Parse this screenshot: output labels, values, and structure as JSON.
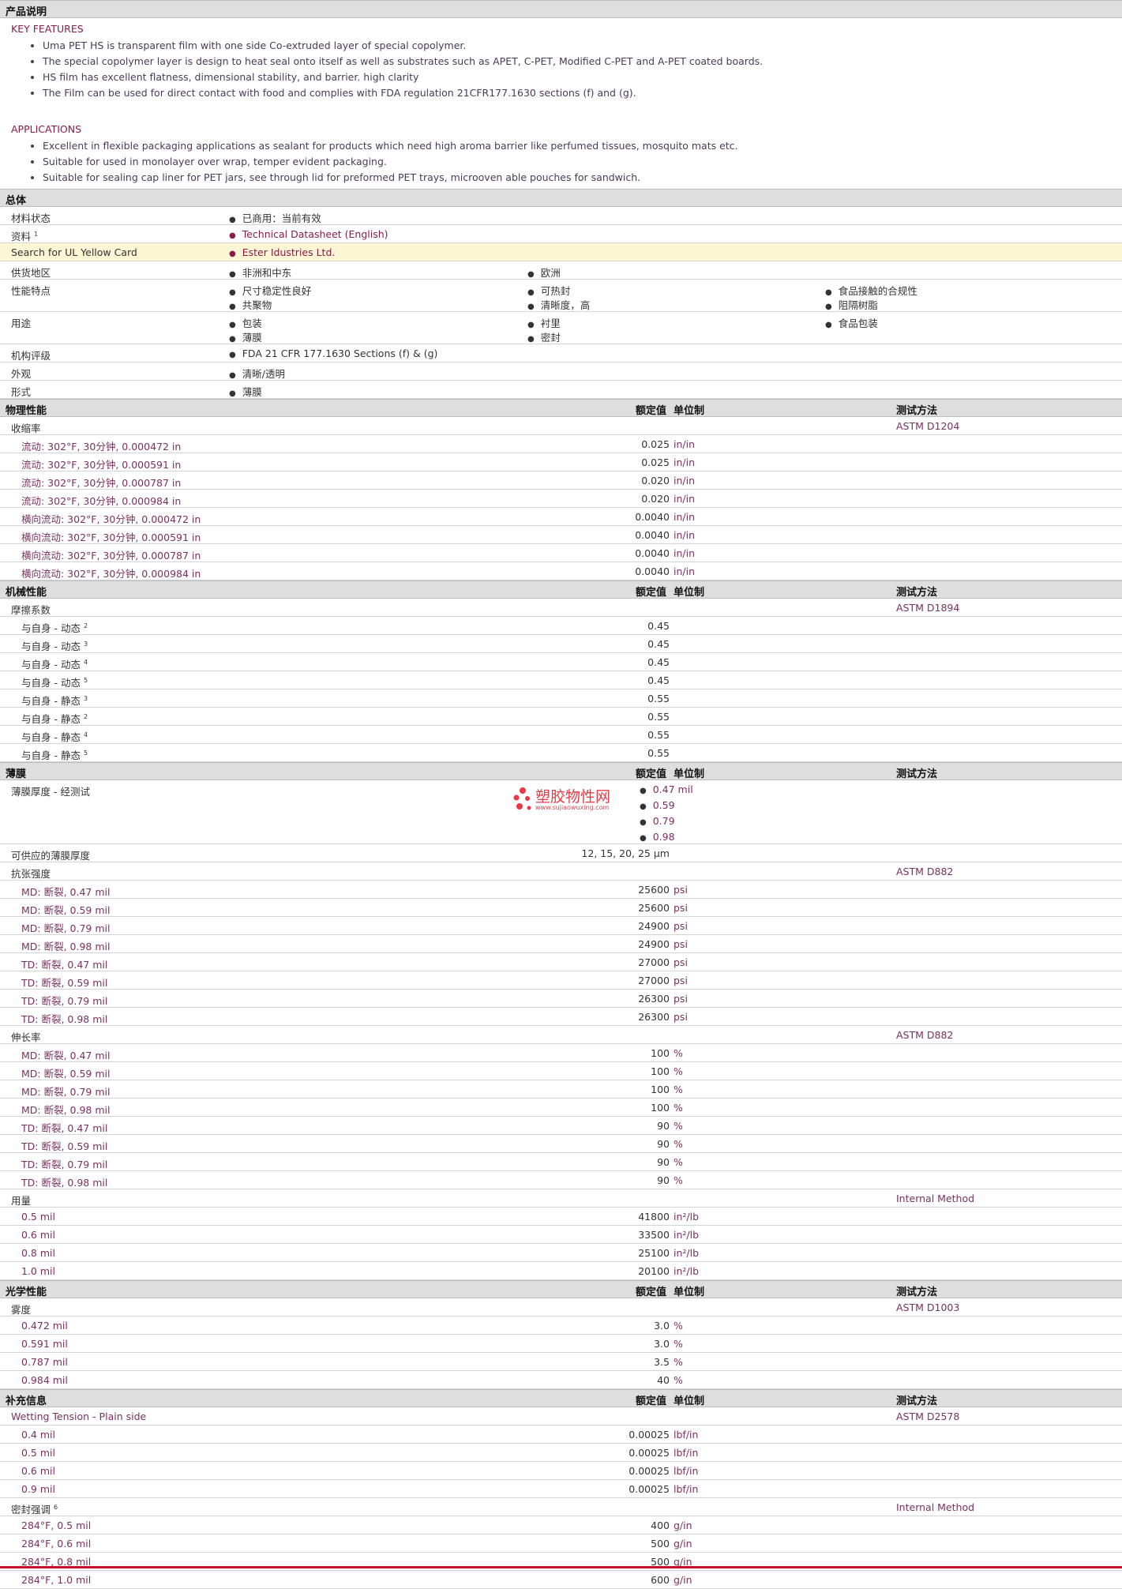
{
  "product_description": {
    "header": "产品说明",
    "key_features_title": "KEY FEATURES",
    "key_features": [
      "Uma PET HS is transparent film with one side Co-extruded layer of special copolymer.",
      "The special copolymer layer is design to heat seal onto itself as well as substrates such as APET, C-PET, Modified C-PET and A-PET coated boards.",
      "HS film has excellent flatness, dimensional stability, and barrier. high clarity",
      "The Film can be used for direct contact with food and complies with FDA regulation 21CFR177.1630 sections (f) and (g)."
    ],
    "applications_title": "APPLICATIONS",
    "applications": [
      "Excellent in flexible packaging applications as sealant for products which need high aroma barrier like perfumed tissues, mosquito mats etc.",
      "Suitable for used in monolayer over wrap, temper evident packaging.",
      "Suitable for sealing cap liner for PET jars, see through lid for preformed PET trays, microoven able pouches for sandwich."
    ]
  },
  "general": {
    "header": "总体",
    "material_status_label": "材料状态",
    "material_status": "已商用：当前有效",
    "docs_label": "资料",
    "docs_sup": "1",
    "docs_link": "Technical Datasheet (English)",
    "ul_label": "Search for UL Yellow Card",
    "ul_link": "Ester Idustries Ltd.",
    "supply_label": "供货地区",
    "supply": [
      "非洲和中东",
      "欧洲"
    ],
    "features_label": "性能特点",
    "features": [
      "尺寸稳定性良好",
      "可热封",
      "食品接触的合规性",
      "共聚物",
      "清晰度，高",
      "阻隔树脂"
    ],
    "uses_label": "用途",
    "uses": [
      "包装",
      "衬里",
      "食品包装",
      "薄膜",
      "密封"
    ],
    "agency_label": "机构评级",
    "agency": "FDA 21 CFR 177.1630 Sections (f) & (g)",
    "appearance_label": "外观",
    "appearance": "清晰/透明",
    "form_label": "形式",
    "form": "薄膜"
  },
  "col_headers": {
    "nominal": "额定值",
    "unit": "单位制",
    "method": "测试方法"
  },
  "physical": {
    "header": "物理性能",
    "shrink_label": "收缩率",
    "shrink_method": "ASTM D1204",
    "rows": [
      {
        "label": "流动: 302°F, 30分钟, 0.000472 in",
        "value": "0.025",
        "unit": "in/in"
      },
      {
        "label": "流动: 302°F, 30分钟, 0.000591 in",
        "value": "0.025",
        "unit": "in/in"
      },
      {
        "label": "流动: 302°F, 30分钟, 0.000787 in",
        "value": "0.020",
        "unit": "in/in"
      },
      {
        "label": "流动: 302°F, 30分钟, 0.000984 in",
        "value": "0.020",
        "unit": "in/in"
      },
      {
        "label": "横向流动: 302°F, 30分钟, 0.000472 in",
        "value": "0.0040",
        "unit": "in/in"
      },
      {
        "label": "横向流动: 302°F, 30分钟, 0.000591 in",
        "value": "0.0040",
        "unit": "in/in"
      },
      {
        "label": "横向流动: 302°F, 30分钟, 0.000787 in",
        "value": "0.0040",
        "unit": "in/in"
      },
      {
        "label": "横向流动: 302°F, 30分钟, 0.000984 in",
        "value": "0.0040",
        "unit": "in/in"
      }
    ]
  },
  "mechanical": {
    "header": "机械性能",
    "cof_label": "摩擦系数",
    "cof_method": "ASTM D1894",
    "rows": [
      {
        "label": "与自身 - 动态",
        "sup": "2",
        "value": "0.45"
      },
      {
        "label": "与自身 - 动态",
        "sup": "3",
        "value": "0.45"
      },
      {
        "label": "与自身 - 动态",
        "sup": "4",
        "value": "0.45"
      },
      {
        "label": "与自身 - 动态",
        "sup": "5",
        "value": "0.45"
      },
      {
        "label": "与自身 - 静态",
        "sup": "3",
        "value": "0.55"
      },
      {
        "label": "与自身 - 静态",
        "sup": "2",
        "value": "0.55"
      },
      {
        "label": "与自身 - 静态",
        "sup": "4",
        "value": "0.55"
      },
      {
        "label": "与自身 - 静态",
        "sup": "5",
        "value": "0.55"
      }
    ]
  },
  "film": {
    "header": "薄膜",
    "thickness_label": "薄膜厚度 - 经测试",
    "thickness_values": [
      "0.47 mil",
      "0.59",
      "0.79",
      "0.98"
    ],
    "watermark_main": "塑胶物性网",
    "watermark_sub": "www.sujiaowuxing.com",
    "avail_label": "可供应的薄膜厚度",
    "avail_value": "12, 15, 20, 25 µm",
    "tensile_label": "抗张强度",
    "tensile_method": "ASTM D882",
    "tensile_rows": [
      {
        "label": "MD: 断裂, 0.47 mil",
        "value": "25600",
        "unit": "psi"
      },
      {
        "label": "MD: 断裂, 0.59 mil",
        "value": "25600",
        "unit": "psi"
      },
      {
        "label": "MD: 断裂, 0.79 mil",
        "value": "24900",
        "unit": "psi"
      },
      {
        "label": "MD: 断裂, 0.98 mil",
        "value": "24900",
        "unit": "psi"
      },
      {
        "label": "TD: 断裂, 0.47 mil",
        "value": "27000",
        "unit": "psi"
      },
      {
        "label": "TD: 断裂, 0.59 mil",
        "value": "27000",
        "unit": "psi"
      },
      {
        "label": "TD: 断裂, 0.79 mil",
        "value": "26300",
        "unit": "psi"
      },
      {
        "label": "TD: 断裂, 0.98 mil",
        "value": "26300",
        "unit": "psi"
      }
    ],
    "elong_label": "伸长率",
    "elong_method": "ASTM D882",
    "elong_rows": [
      {
        "label": "MD: 断裂, 0.47 mil",
        "value": "100",
        "unit": "%"
      },
      {
        "label": "MD: 断裂, 0.59 mil",
        "value": "100",
        "unit": "%"
      },
      {
        "label": "MD: 断裂, 0.79 mil",
        "value": "100",
        "unit": "%"
      },
      {
        "label": "MD: 断裂, 0.98 mil",
        "value": "100",
        "unit": "%"
      },
      {
        "label": "TD: 断裂, 0.47 mil",
        "value": "90",
        "unit": "%"
      },
      {
        "label": "TD: 断裂, 0.59 mil",
        "value": "90",
        "unit": "%"
      },
      {
        "label": "TD: 断裂, 0.79 mil",
        "value": "90",
        "unit": "%"
      },
      {
        "label": "TD: 断裂, 0.98 mil",
        "value": "90",
        "unit": "%"
      }
    ],
    "yield_label": "用量",
    "yield_method": "Internal Method",
    "yield_rows": [
      {
        "label": "0.5 mil",
        "value": "41800",
        "unit": "in²/lb"
      },
      {
        "label": "0.6 mil",
        "value": "33500",
        "unit": "in²/lb"
      },
      {
        "label": "0.8 mil",
        "value": "25100",
        "unit": "in²/lb"
      },
      {
        "label": "1.0 mil",
        "value": "20100",
        "unit": "in²/lb"
      }
    ]
  },
  "optical": {
    "header": "光学性能",
    "haze_label": "雾度",
    "haze_method": "ASTM D1003",
    "rows": [
      {
        "label": "0.472 mil",
        "value": "3.0",
        "unit": "%"
      },
      {
        "label": "0.591 mil",
        "value": "3.0",
        "unit": "%"
      },
      {
        "label": "0.787 mil",
        "value": "3.5",
        "unit": "%"
      },
      {
        "label": "0.984 mil",
        "value": "40",
        "unit": "%"
      }
    ]
  },
  "additional": {
    "header": "补充信息",
    "wetting_label": "Wetting Tension - Plain side",
    "wetting_method": "ASTM D2578",
    "wetting_rows": [
      {
        "label": "0.4 mil",
        "value": "0.00025",
        "unit": "lbf/in"
      },
      {
        "label": "0.5 mil",
        "value": "0.00025",
        "unit": "lbf/in"
      },
      {
        "label": "0.6 mil",
        "value": "0.00025",
        "unit": "lbf/in"
      },
      {
        "label": "0.9 mil",
        "value": "0.00025",
        "unit": "lbf/in"
      }
    ],
    "seal_label": "密封强调",
    "seal_sup": "6",
    "seal_method": "Internal Method",
    "seal_rows": [
      {
        "label": "284°F, 0.5 mil",
        "value": "400",
        "unit": "g/in"
      },
      {
        "label": "284°F, 0.6 mil",
        "value": "500",
        "unit": "g/in"
      },
      {
        "label": "284°F, 0.8 mil",
        "value": "500",
        "unit": "g/in"
      },
      {
        "label": "284°F, 1.0 mil",
        "value": "600",
        "unit": "g/in"
      }
    ]
  },
  "colors": {
    "accent": "#8b1a4a",
    "header_bg": "#dedede",
    "highlight": "#fcf6d5",
    "watermark": "#e63b45"
  }
}
